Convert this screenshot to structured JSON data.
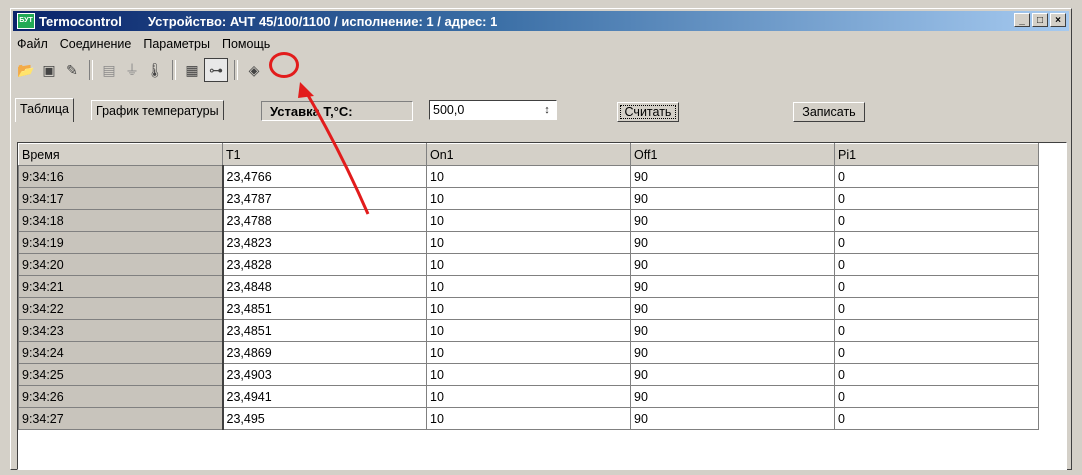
{
  "window": {
    "app_name": "Termocontrol",
    "title": "Устройство: АЧТ 45/100/1100 / исполнение: 1 / адрес: 1",
    "app_icon_text": "БУТ",
    "controls": {
      "minimize": "_",
      "maximize": "□",
      "close": "×"
    }
  },
  "menu": [
    "Файл",
    "Соединение",
    "Параметры",
    "Помощь"
  ],
  "toolbar": {
    "icons": [
      "open-folder-icon",
      "chip-icon",
      "eraser-icon",
      "print-icon",
      "plug-icon",
      "thermometer-icon",
      "settings-table-icon",
      "disconnect-icon",
      "book-icon"
    ]
  },
  "tabs": [
    "Таблица",
    "График температуры"
  ],
  "setpoint": {
    "label": "Уставка Т,°С:",
    "value": "500,0"
  },
  "buttons": {
    "read": "Считать",
    "write": "Записать"
  },
  "table": {
    "columns": [
      "Время",
      "T1",
      "On1",
      "Off1",
      "Pi1"
    ],
    "rows": [
      [
        "9:34:16",
        "23,4766",
        "10",
        "90",
        "0"
      ],
      [
        "9:34:17",
        "23,4787",
        "10",
        "90",
        "0"
      ],
      [
        "9:34:18",
        "23,4788",
        "10",
        "90",
        "0"
      ],
      [
        "9:34:19",
        "23,4823",
        "10",
        "90",
        "0"
      ],
      [
        "9:34:20",
        "23,4828",
        "10",
        "90",
        "0"
      ],
      [
        "9:34:21",
        "23,4848",
        "10",
        "90",
        "0"
      ],
      [
        "9:34:22",
        "23,4851",
        "10",
        "90",
        "0"
      ],
      [
        "9:34:23",
        "23,4851",
        "10",
        "90",
        "0"
      ],
      [
        "9:34:24",
        "23,4869",
        "10",
        "90",
        "0"
      ],
      [
        "9:34:25",
        "23,4903",
        "10",
        "90",
        "0"
      ],
      [
        "9:34:26",
        "23,4941",
        "10",
        "90",
        "0"
      ],
      [
        "9:34:27",
        "23,495",
        "10",
        "90",
        "0"
      ]
    ]
  },
  "colors": {
    "annotation": "#e21c1c",
    "titlebar": "#0a246a"
  }
}
